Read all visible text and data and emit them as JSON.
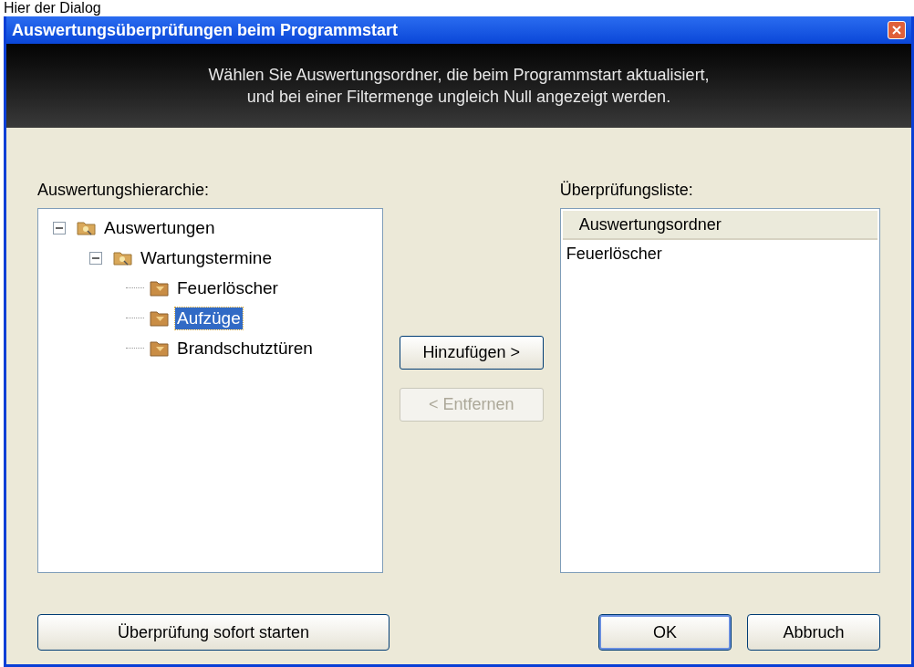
{
  "caption": "Hier der Dialog",
  "window": {
    "title": "Auswertungsüberprüfungen beim Programmstart"
  },
  "banner": {
    "lines": [
      "Wählen Sie Auswertungsordner, die beim Programmstart aktualisiert,",
      "und bei einer Filtermenge ungleich Null angezeigt werden."
    ]
  },
  "hierarchy": {
    "label": "Auswertungshierarchie:",
    "items": [
      {
        "label": "Auswertungen",
        "kind": "group",
        "expanded": true,
        "selected": false,
        "children": [
          {
            "label": "Wartungstermine",
            "kind": "group",
            "expanded": true,
            "selected": false,
            "children": [
              {
                "label": "Feuerlöscher",
                "kind": "filter",
                "selected": false
              },
              {
                "label": "Aufzüge",
                "kind": "filter",
                "selected": true
              },
              {
                "label": "Brandschutztüren",
                "kind": "filter",
                "selected": false
              }
            ]
          }
        ]
      }
    ]
  },
  "middle_buttons": [
    {
      "label": "Hinzufügen >",
      "disabled": false
    },
    {
      "label": "< Entfernen",
      "disabled": true
    }
  ],
  "check_list": {
    "label": "Überprüfungsliste:",
    "column": "Auswertungsordner",
    "rows": [
      "Feuerlöscher"
    ]
  },
  "footer": {
    "start_button": "Überprüfung sofort starten",
    "buttons": [
      {
        "label": "OK",
        "default": true
      },
      {
        "label": "Abbruch",
        "default": false
      }
    ]
  }
}
